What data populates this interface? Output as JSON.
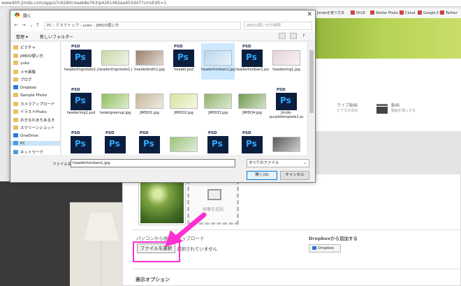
{
  "browser": {
    "url": "www400.jimdo.com/app/s7c6280c4aab8e763/p4261462ea455d47?cmsEdit=1",
    "bookmarks": [
      "Jimdoを使う方法",
      "0018",
      "Stellar Photo",
      "Cloud",
      "Googleスケ",
      "Twitter"
    ]
  },
  "editor": {
    "add_blocks": [
      {
        "title": "ライブ動画",
        "subtitle": "ビデオの追加"
      },
      {
        "title": "動画",
        "subtitle": "動画を挿入する"
      }
    ],
    "drop_label": "画像を追加",
    "pc_upload_title": "パソコンから画像をアップロード",
    "file_button": "ファイルを選択",
    "no_file": "選択されていません",
    "dropbox_title": "Dropboxから追加する",
    "dropbox_button": "Dropbox",
    "display_options": "表示オプション"
  },
  "dialog": {
    "title": "開く",
    "path": "PC › デスクトップ › yuko › JIMDO使い方",
    "search_placeholder": "JIMDO使い方の検索",
    "toolbar": {
      "organize": "整理 ▾",
      "new_folder": "新しいフォルダー"
    },
    "sidebar": [
      {
        "label": "ピクチャ",
        "type": "folder"
      },
      {
        "label": "JIMDO使い方",
        "type": "folder"
      },
      {
        "label": "yuko",
        "type": "folder"
      },
      {
        "label": "メモ画像",
        "type": "folder"
      },
      {
        "label": "ブログ",
        "type": "folder"
      },
      {
        "label": "Dropbox",
        "type": "blue"
      },
      {
        "label": "Sample Photo",
        "type": "folder"
      },
      {
        "label": "カメラアップロード",
        "type": "folder"
      },
      {
        "label": "イラストPhoto",
        "type": "folder"
      },
      {
        "label": "おきなわまちあるき",
        "type": "folder"
      },
      {
        "label": "スクリーンショット",
        "type": "folder"
      },
      {
        "label": "OneDrive",
        "type": "blue"
      },
      {
        "label": "PC",
        "type": "pc",
        "selected": true
      },
      {
        "label": "ネットワーク",
        "type": "pc"
      }
    ],
    "files": [
      {
        "name": "headerimgrotate1.psd",
        "kind": "psd"
      },
      {
        "name": "headerimgrotate1.jpg",
        "kind": "img",
        "color": "#c9d8a8"
      },
      {
        "name": "headerbroth1.jpg",
        "kind": "img",
        "color": "#9a7f6a"
      },
      {
        "name": "header.psd",
        "kind": "psd"
      },
      {
        "name": "headerhonban1.jpg",
        "kind": "img",
        "color": "#b8d6ef",
        "selected": true
      },
      {
        "name": "headerhonban1.psd",
        "kind": "psd"
      },
      {
        "name": "headerimg1.jpg",
        "kind": "img",
        "color": "#e8d2d8"
      },
      {
        "name": "headerimg1.psd",
        "kind": "psd"
      },
      {
        "name": "hedergreenup.jpg",
        "kind": "img",
        "color": "#8fbf5c"
      },
      {
        "name": "JIMDO1.jpg",
        "kind": "img",
        "color": "#c5b79a"
      },
      {
        "name": "JIMDO2.jpg",
        "kind": "img",
        "color": "#d9e3a0"
      },
      {
        "name": "JIMDO3.jpg",
        "kind": "img",
        "color": "#8fb36a"
      },
      {
        "name": "JIMDO4.jpg",
        "kind": "img",
        "color": "#6f9a4b"
      },
      {
        "name": "jimdo-purpletemplate1.psd",
        "kind": "psd"
      },
      {
        "name": "",
        "kind": "psd"
      },
      {
        "name": "",
        "kind": "psd"
      },
      {
        "name": "",
        "kind": "psd"
      },
      {
        "name": "",
        "kind": "img",
        "color": "#9bc27a"
      },
      {
        "name": "",
        "kind": "psd"
      },
      {
        "name": "",
        "kind": "psd"
      },
      {
        "name": "",
        "kind": "img",
        "color": "#5a5a5a"
      }
    ],
    "filename_label": "ファイル名(N):",
    "filename_value": "headerhonban1.jpg",
    "filetype": "すべてのファイル",
    "open_button": "開く(O)",
    "cancel_button": "キャンセル"
  },
  "colors": {
    "highlight": "#ff2fd2",
    "arrow": "#ff2fd2",
    "accent": "#0078d7"
  }
}
